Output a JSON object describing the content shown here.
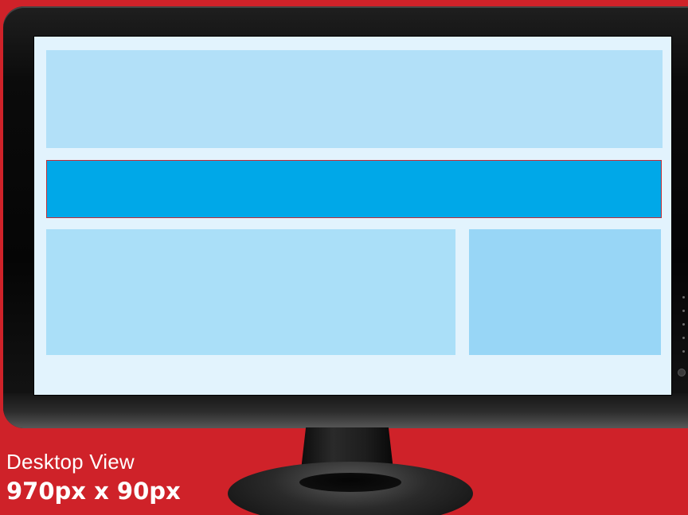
{
  "caption": {
    "label": "Desktop View",
    "size": "970px x 90px"
  },
  "colors": {
    "background": "#cf2229",
    "screen": "#e2f3fd",
    "header_block": "#b2e0f8",
    "ad_block": "#00a8e8",
    "main_block": "#aadff8",
    "side_block": "#98d6f6",
    "ad_border": "#c2303a"
  },
  "icons": {
    "bezel": "bezel-indicator-dot",
    "power": "power-button-icon"
  }
}
